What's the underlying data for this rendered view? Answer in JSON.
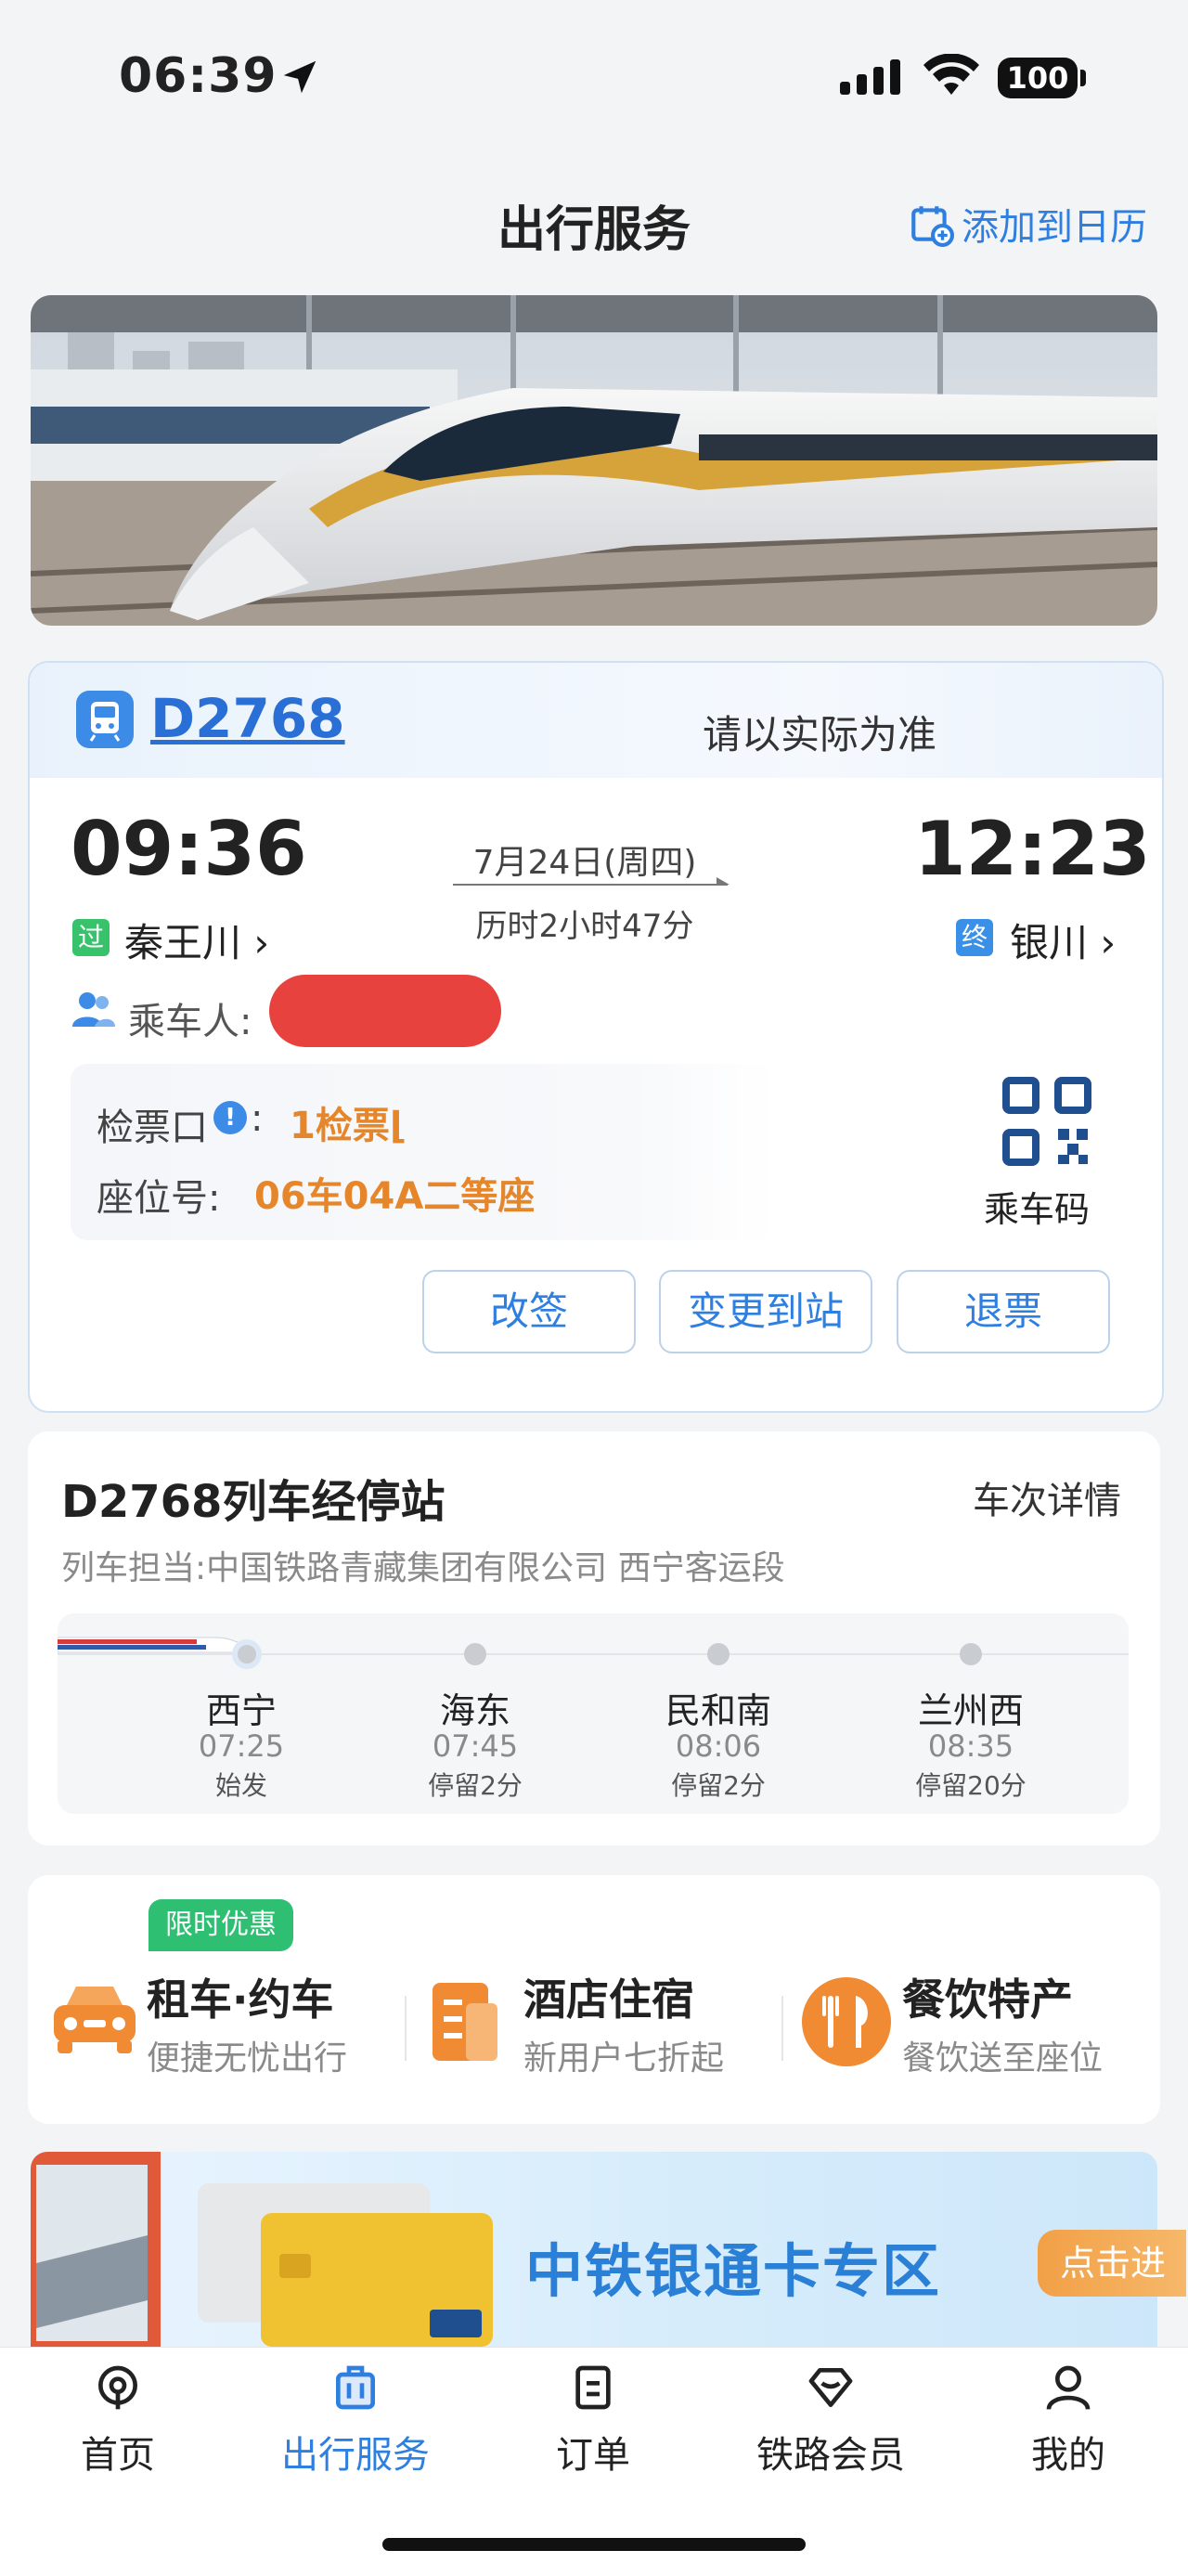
{
  "status_bar": {
    "time": "06:39",
    "battery": "100"
  },
  "header": {
    "title": "出行服务",
    "calendar_label": "添加到日历"
  },
  "ticket": {
    "train_no": "D2768",
    "notice": "请以实际为准",
    "departure": {
      "time": "09:36",
      "tag": "过",
      "station": "秦王川 ›"
    },
    "arrival": {
      "time": "12:23",
      "tag": "终",
      "station": "银川 ›"
    },
    "date": "7月24日(周四)",
    "duration": "历时2小时47分",
    "passenger_label": "乘车人:",
    "gate_label": "检票口",
    "gate_colon": ":",
    "gate_value": "1检票⌊",
    "seat_label": "座位号:",
    "seat_value": "06车04A二等座",
    "qr_label": "乘车码",
    "buttons": [
      "改签",
      "变更到站",
      "退票"
    ]
  },
  "stops": {
    "title": "D2768列车经停站",
    "detail_link": "车次详情",
    "operator": "列车担当:中国铁路青藏集团有限公司 西宁客运段",
    "list": [
      {
        "name": "西宁",
        "time": "07:25",
        "note": "始发"
      },
      {
        "name": "海东",
        "time": "07:45",
        "note": "停留2分"
      },
      {
        "name": "民和南",
        "time": "08:06",
        "note": "停留2分"
      },
      {
        "name": "兰州西",
        "time": "08:35",
        "note": "停留20分"
      }
    ]
  },
  "services": {
    "promo_tag": "限时优惠",
    "items": [
      {
        "title": "租车·约车",
        "subtitle": "便捷无忧出行",
        "icon": "car-icon"
      },
      {
        "title": "酒店住宿",
        "subtitle": "新用户七折起",
        "icon": "hotel-icon"
      },
      {
        "title": "餐饮特产",
        "subtitle": "餐饮送至座位",
        "icon": "dining-icon"
      }
    ]
  },
  "ad": {
    "text": "中铁银通卡专区",
    "button": "点击进"
  },
  "nav": {
    "items": [
      {
        "label": "首页",
        "icon": "home-icon"
      },
      {
        "label": "出行服务",
        "icon": "luggage-icon"
      },
      {
        "label": "订单",
        "icon": "order-icon"
      },
      {
        "label": "铁路会员",
        "icon": "member-icon"
      },
      {
        "label": "我的",
        "icon": "profile-icon"
      }
    ],
    "active_index": 1
  },
  "colors": {
    "accent": "#2f7fe0",
    "orange": "#e6862b",
    "green": "#37c26b"
  }
}
